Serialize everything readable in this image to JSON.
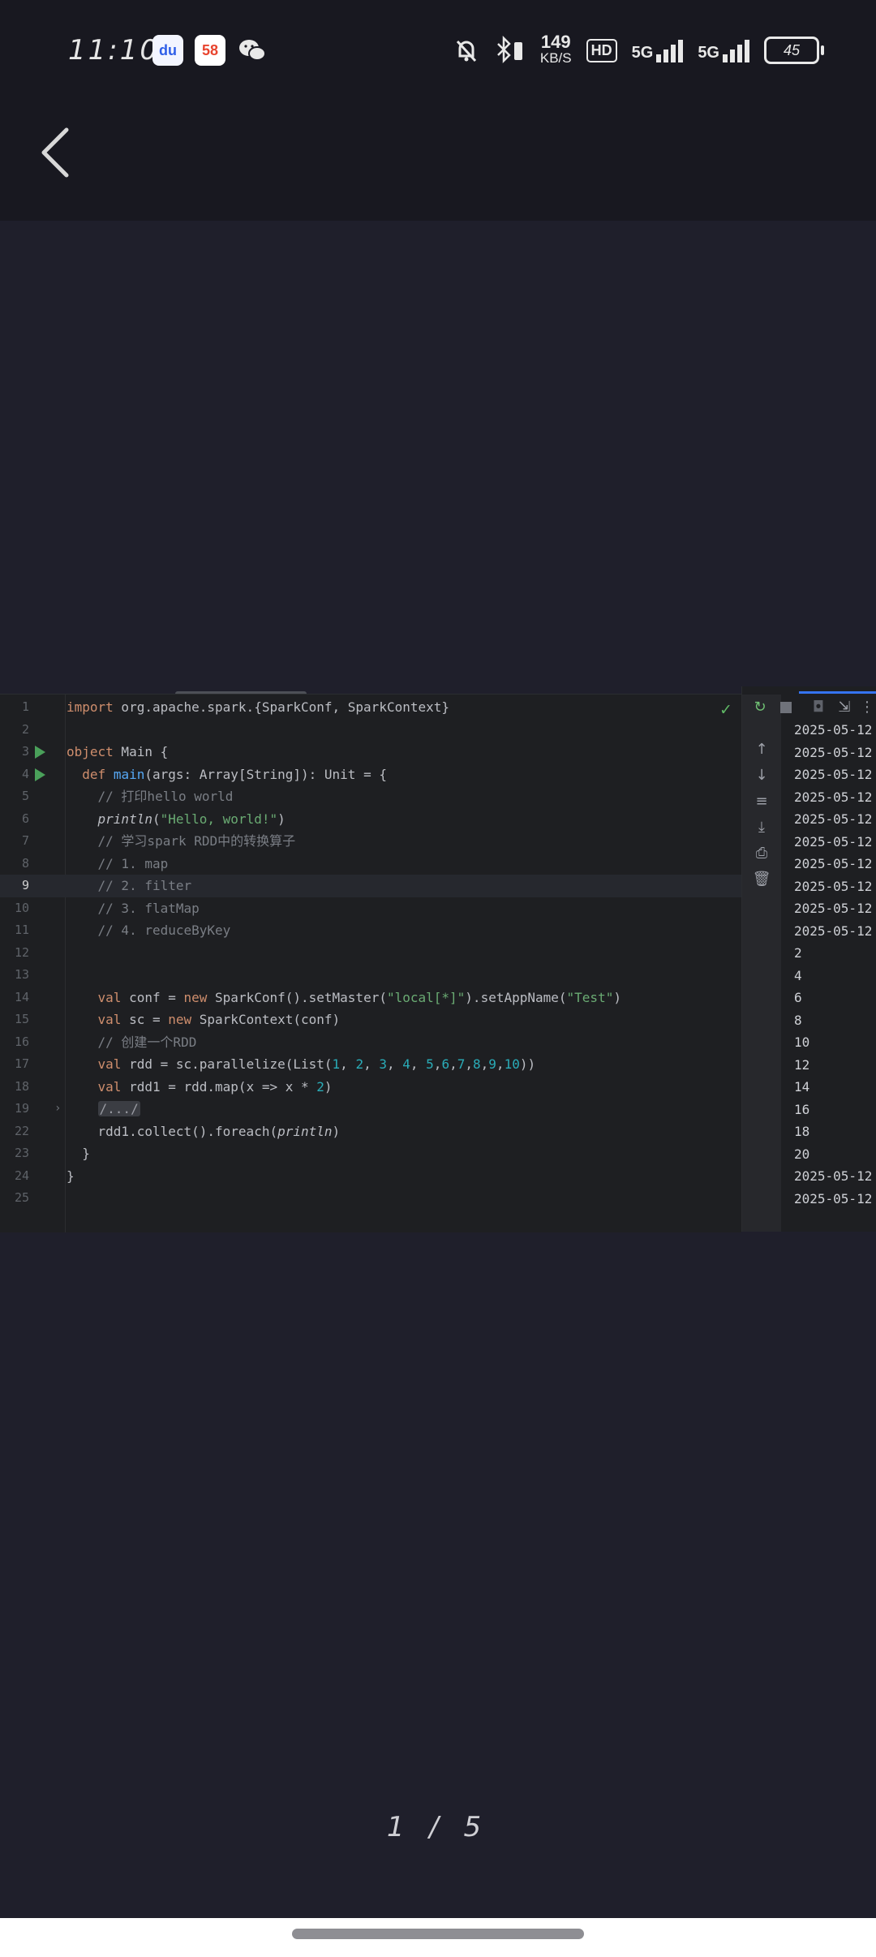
{
  "status_bar": {
    "time": "11:10",
    "apps": [
      {
        "name": "baidu",
        "label": "du"
      },
      {
        "name": "58",
        "label": "58"
      },
      {
        "name": "wechat",
        "label": ""
      }
    ],
    "speed_value": "149",
    "speed_unit": "KB/S",
    "hd_label": "HD",
    "network_1": "5G",
    "network_2": "5G",
    "battery": "45"
  },
  "viewer": {
    "page_indicator": "1 / 5"
  },
  "editor": {
    "lines": [
      {
        "n": "1",
        "html": "<span class=\"kw\">import</span> org.apache.spark.{SparkConf, SparkContext}"
      },
      {
        "n": "2",
        "html": ""
      },
      {
        "n": "3",
        "html": "<span class=\"kw\">object</span> Main {",
        "run": true
      },
      {
        "n": "4",
        "html": "  <span class=\"kw\">def</span> <span class=\"fn\">main</span>(args: Array[String]): Unit = {",
        "run": true
      },
      {
        "n": "5",
        "html": "    <span class=\"cmt\">// 打印hello world</span>"
      },
      {
        "n": "6",
        "html": "    <span class=\"it\">println</span>(<span class=\"str\">\"Hello, world!\"</span>)"
      },
      {
        "n": "7",
        "html": "    <span class=\"cmt\">// 学习spark RDD中的转换算子</span>"
      },
      {
        "n": "8",
        "html": "    <span class=\"cmt\">// 1. map</span>"
      },
      {
        "n": "9",
        "html": "    <span class=\"cmt\">// 2. filter</span>",
        "current": true
      },
      {
        "n": "10",
        "html": "    <span class=\"cmt\">// 3. flatMap</span>"
      },
      {
        "n": "11",
        "html": "    <span class=\"cmt\">// 4. reduceByKey</span>"
      },
      {
        "n": "12",
        "html": ""
      },
      {
        "n": "13",
        "html": ""
      },
      {
        "n": "14",
        "html": "    <span class=\"kw\">val</span> conf = <span class=\"kw\">new</span> SparkConf().setMaster(<span class=\"str\">\"local[*]\"</span>).setAppName(<span class=\"str\">\"Test\"</span>)"
      },
      {
        "n": "15",
        "html": "    <span class=\"kw\">val</span> sc = <span class=\"kw\">new</span> SparkContext(conf)"
      },
      {
        "n": "16",
        "html": "    <span class=\"cmt\">// 创建一个RDD</span>"
      },
      {
        "n": "17",
        "html": "    <span class=\"kw\">val</span> rdd = sc.parallelize(List(<span class=\"num\">1</span>, <span class=\"num\">2</span>, <span class=\"num\">3</span>, <span class=\"num\">4</span>, <span class=\"num\">5</span>,<span class=\"num\">6</span>,<span class=\"num\">7</span>,<span class=\"num\">8</span>,<span class=\"num\">9</span>,<span class=\"num\">10</span>))"
      },
      {
        "n": "18",
        "html": "    <span class=\"kw\">val</span> rdd1 = rdd.map(x =&gt; x * <span class=\"num\">2</span>)"
      },
      {
        "n": "19",
        "html": "    <span class=\"fold\">/.../</span>",
        "fold": true
      },
      {
        "n": "22",
        "html": "    rdd1.collect().foreach(<span class=\"it\">println</span>)"
      },
      {
        "n": "23",
        "html": "  }"
      },
      {
        "n": "24",
        "html": "}"
      },
      {
        "n": "25",
        "html": ""
      }
    ]
  },
  "run_output": {
    "lines": [
      "2025-05-12",
      "2025-05-12",
      "2025-05-12",
      "2025-05-12",
      "2025-05-12",
      "2025-05-12",
      "2025-05-12",
      "2025-05-12",
      "2025-05-12",
      "2025-05-12",
      "2",
      "4",
      "6",
      "8",
      "10",
      "12",
      "14",
      "16",
      "18",
      "20",
      "2025-05-12",
      "2025-05-12"
    ]
  }
}
